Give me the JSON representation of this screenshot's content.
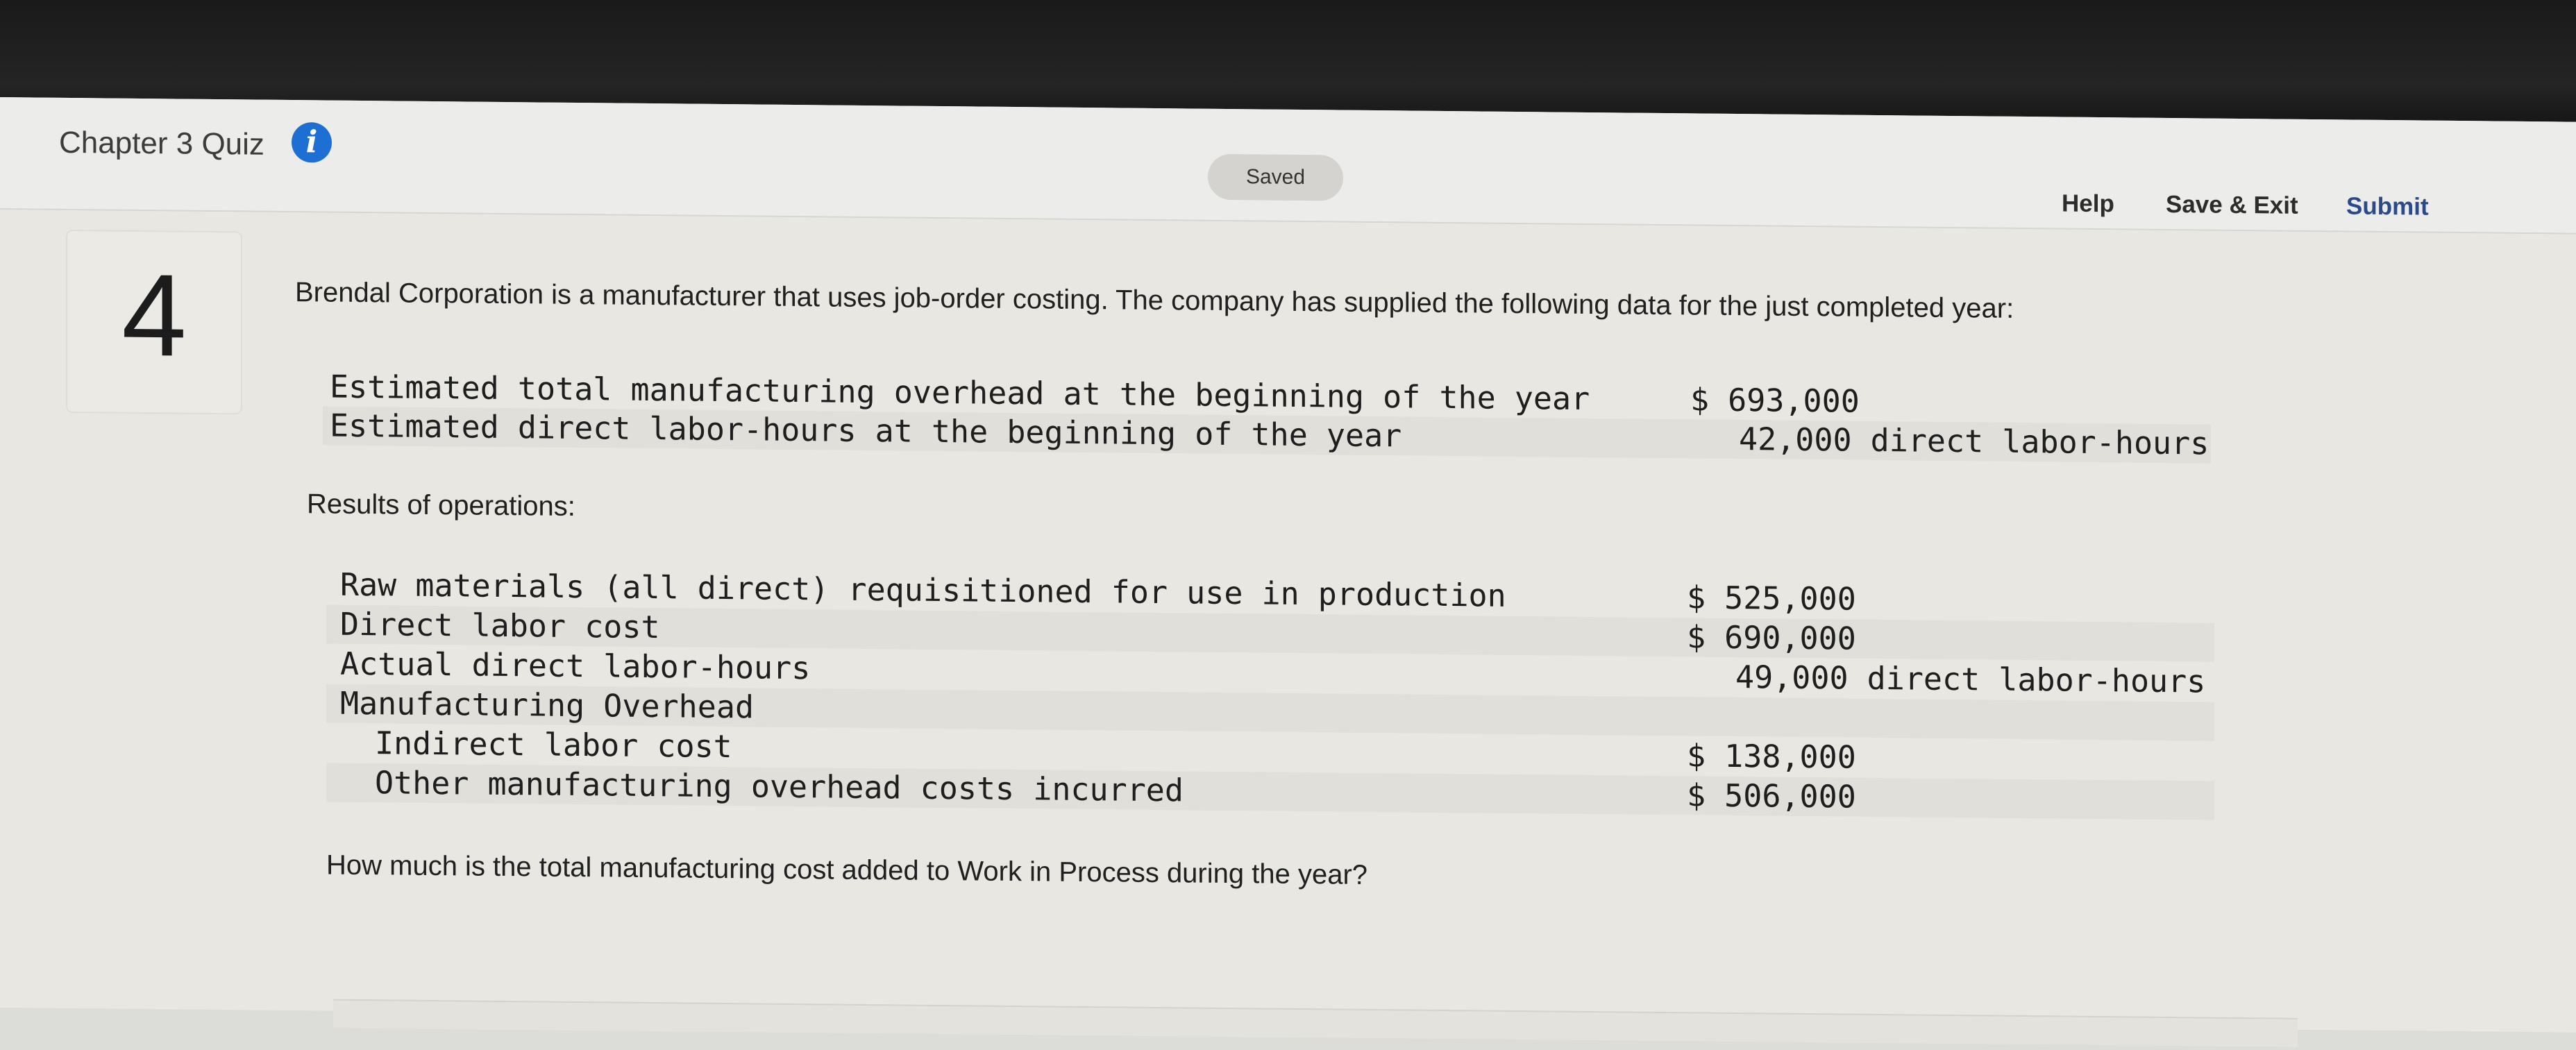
{
  "header": {
    "quiz_title": "Chapter 3 Quiz",
    "info_icon": "info-icon",
    "saved_label": "Saved",
    "help_label": "Help",
    "save_exit_label": "Save & Exit",
    "submit_label": "Submit"
  },
  "question": {
    "number": "4",
    "prompt": "Brendal Corporation is a manufacturer that uses job-order costing. The company has supplied the following data for the just completed year:",
    "estimates": [
      {
        "label": "Estimated total manufacturing overhead at the beginning of the year",
        "value": "$ 693,000"
      },
      {
        "label": "Estimated direct labor-hours at the beginning of the year",
        "value": "42,000 direct labor-hours"
      }
    ],
    "results_heading": "Results of operations:",
    "results": [
      {
        "label": "Raw materials (all direct) requisitioned for use in production",
        "value": "$ 525,000"
      },
      {
        "label": "Direct labor cost",
        "value": "$ 690,000"
      },
      {
        "label": "Actual direct labor-hours",
        "value": "49,000 direct labor-hours"
      },
      {
        "label": "Manufacturing Overhead",
        "value": ""
      },
      {
        "label": "Indirect labor cost",
        "value": "$ 138,000"
      },
      {
        "label": "Other manufacturing overhead costs incurred",
        "value": "$ 506,000"
      }
    ],
    "ask": "How much is the total manufacturing cost added to Work in Process during the year?"
  }
}
